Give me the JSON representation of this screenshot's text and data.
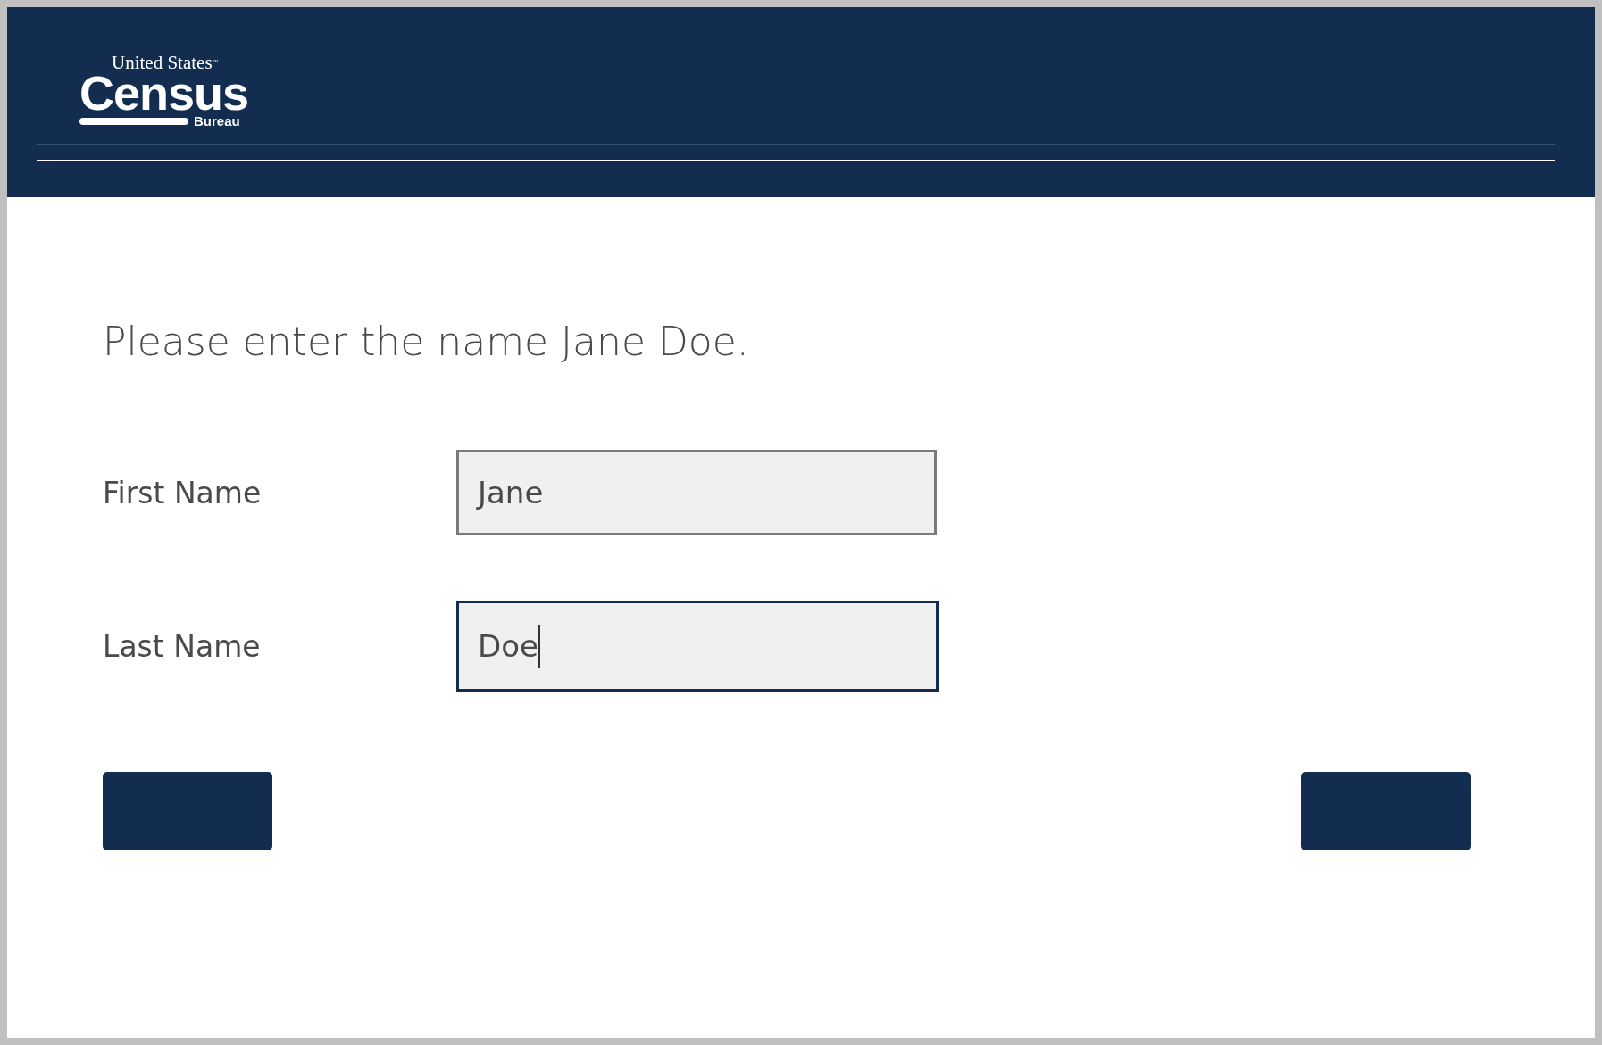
{
  "logo": {
    "top": "United States",
    "trademark": "™",
    "main": "Census",
    "bottom": "Bureau"
  },
  "prompt": "Please enter the name Jane Doe.",
  "fields": [
    {
      "label": "First Name",
      "value": "Jane",
      "focused": false
    },
    {
      "label": "Last Name",
      "value": "Doe",
      "focused": true
    }
  ],
  "buttons": [
    {
      "kind": "back"
    },
    {
      "kind": "next"
    }
  ]
}
